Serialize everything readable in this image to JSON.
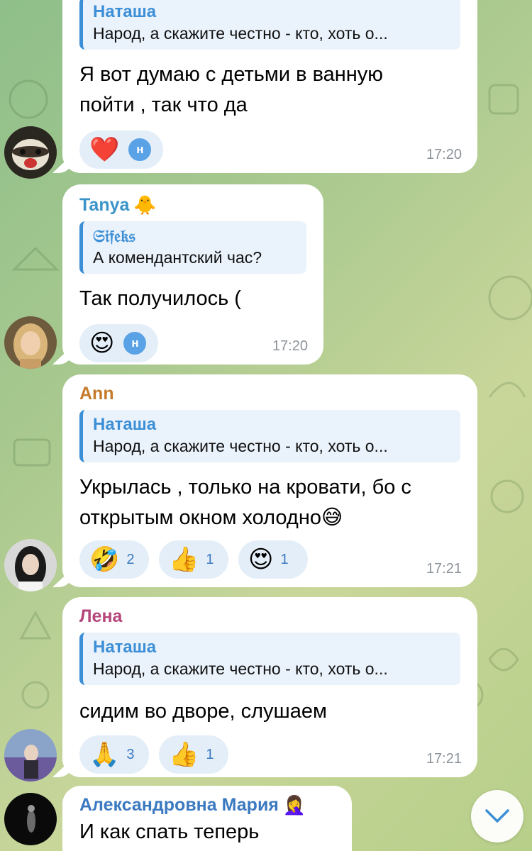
{
  "colors": {
    "bubble": "#ffffff",
    "quote_accent": "#3c8fd6",
    "reaction_bg": "#e4eef8",
    "reaction_count": "#3b79c0"
  },
  "messages": [
    {
      "sender": "",
      "sender_color": "",
      "reply": {
        "name": "Наташа",
        "text": "Народ, а скажите честно - кто, хоть о..."
      },
      "text_lines": [
        "Я вот думаю с детьми в ванную",
        "пойти , так что да"
      ],
      "reactions": [
        {
          "emoji": "❤️",
          "avatar": "н"
        }
      ],
      "time": "17:20",
      "avatar": "ferret-avatar"
    },
    {
      "sender": "Tanya",
      "sender_icon": "🐥",
      "sender_color": "#3b94c9",
      "reply": {
        "name": "𝔖𝔦𝔣𝔢𝔨𝔰",
        "text": "А комендантский час?"
      },
      "text_lines": [
        "Так получилось ("
      ],
      "reactions": [
        {
          "emoji": "😍",
          "avatar": "н"
        }
      ],
      "time": "17:20",
      "avatar": "blonde-woman-avatar"
    },
    {
      "sender": "Ann",
      "sender_color": "#c57a2a",
      "reply": {
        "name": "Наташа",
        "text": "Народ, а скажите честно - кто, хоть о..."
      },
      "text_lines": [
        "Укрылась , только на кровати, бо с",
        "открытым окном холодно😅"
      ],
      "reactions": [
        {
          "emoji": "🤣",
          "count": "2"
        },
        {
          "emoji": "👍",
          "count": "1"
        },
        {
          "emoji": "😍",
          "count": "1"
        }
      ],
      "time": "17:21",
      "avatar": "dark-hair-woman-avatar"
    },
    {
      "sender": "Лена",
      "sender_color": "#b5467c",
      "reply": {
        "name": "Наташа",
        "text": "Народ, а скажите честно - кто, хоть о..."
      },
      "text_lines": [
        "сидим во дворе, слушаем"
      ],
      "reactions": [
        {
          "emoji": "🙏",
          "count": "3"
        },
        {
          "emoji": "👍",
          "count": "1"
        }
      ],
      "time": "17:21",
      "avatar": "lavender-field-avatar"
    },
    {
      "sender": "Александровна Мария",
      "sender_icon": "🤦‍♀️",
      "sender_color": "#3b79c0",
      "text_lines": [
        "И как спать теперь"
      ],
      "avatar": "night-photo-avatar"
    }
  ],
  "scroll_button_icon": "chevron-down-icon"
}
